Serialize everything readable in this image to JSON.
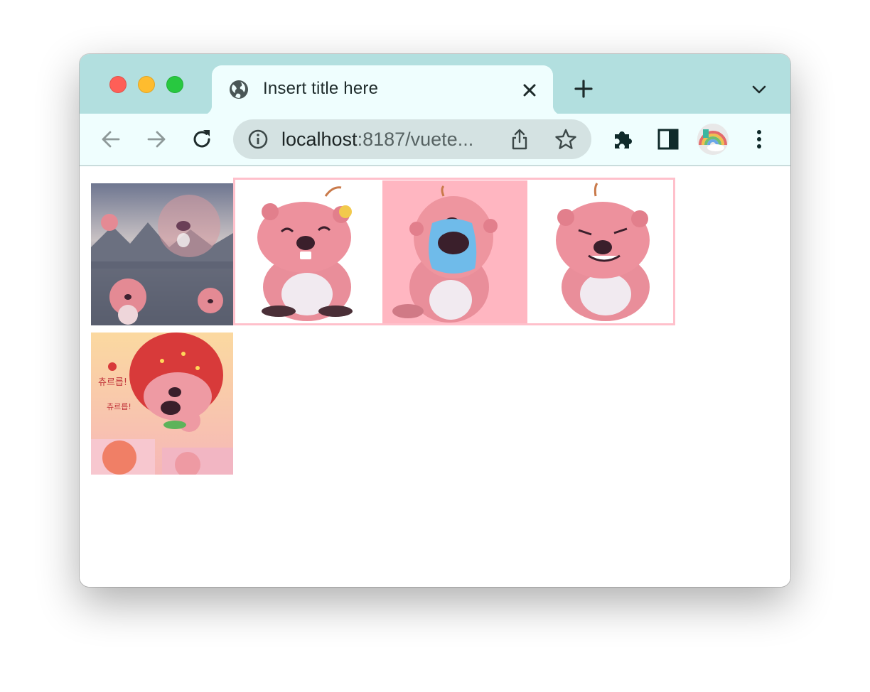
{
  "browser": {
    "tab_title": "Insert title here",
    "url_host": "localhost",
    "url_rest": ":8187/vuete...",
    "icons": [
      "globe-icon",
      "close-icon",
      "plus-icon",
      "chevron-down-icon",
      "back-arrow-icon",
      "forward-arrow-icon",
      "reload-icon",
      "info-icon",
      "share-icon",
      "star-icon",
      "puzzle-icon",
      "side-panel-icon",
      "kebab-menu-icon"
    ]
  },
  "colors": {
    "tabstrip_bg": "#b2dfdf",
    "toolbar_bg": "#effefe",
    "omnibox_bg": "#d4e2e2",
    "highlight_border": "#ffc0cb",
    "highlight_cell_bg": "#ffb6c1"
  },
  "gallery": {
    "row1": [
      "image-1",
      "image-2",
      "image-3",
      "image-4"
    ],
    "row2": [
      "image-5"
    ],
    "poster_text": [
      "츄르릅!",
      "츄르릅!"
    ]
  }
}
